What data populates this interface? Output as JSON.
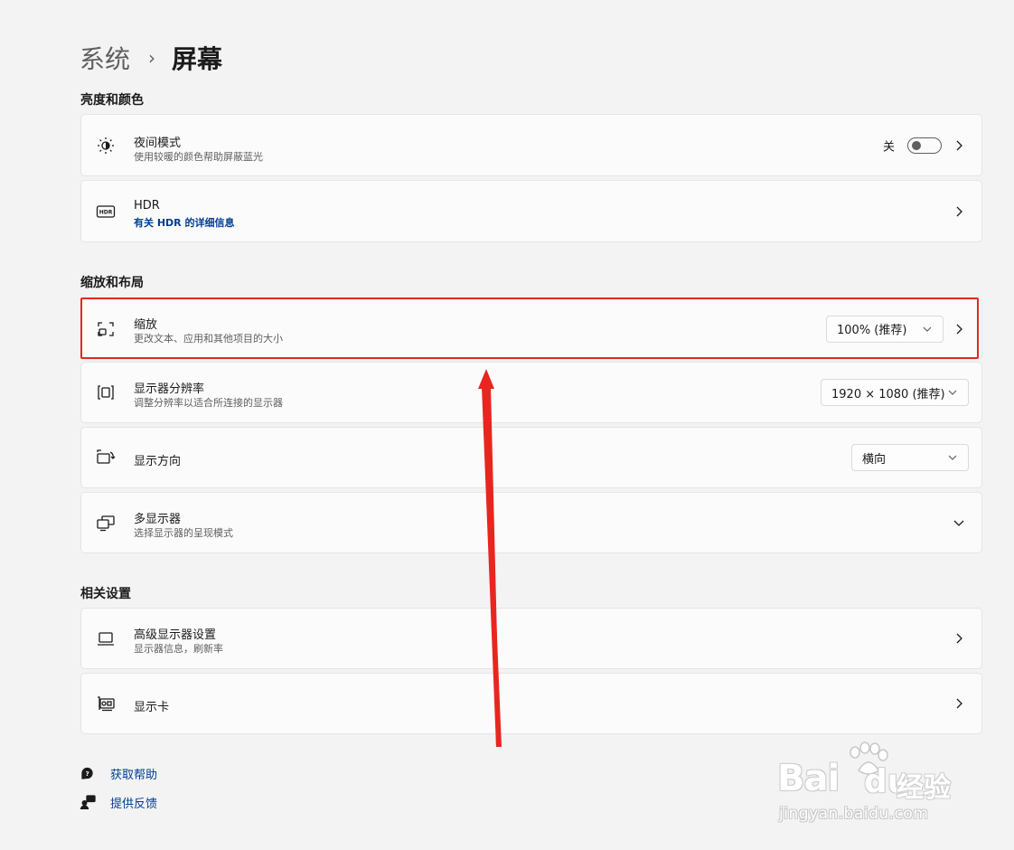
{
  "breadcrumb": {
    "parent": "系统",
    "separator": "›",
    "current": "屏幕"
  },
  "sections": {
    "brightness": "亮度和颜色",
    "scale_layout": "缩放和布局",
    "related": "相关设置"
  },
  "night_mode": {
    "title": "夜间模式",
    "subtitle": "使用较暖的颜色帮助屏蔽蓝光",
    "state_label": "关",
    "icon": "sun-moon-icon"
  },
  "hdr": {
    "title": "HDR",
    "subtitle": "有关 HDR 的详细信息",
    "icon": "hdr-icon"
  },
  "scale": {
    "title": "缩放",
    "subtitle": "更改文本、应用和其他项目的大小",
    "value": "100% (推荐)",
    "icon": "scale-icon"
  },
  "resolution": {
    "title": "显示器分辨率",
    "subtitle": "调整分辨率以适合所连接的显示器",
    "value": "1920 × 1080 (推荐)",
    "icon": "resolution-icon"
  },
  "orientation": {
    "title": "显示方向",
    "value": "横向",
    "icon": "orientation-icon"
  },
  "multi_display": {
    "title": "多显示器",
    "subtitle": "选择显示器的呈现模式",
    "icon": "multi-display-icon"
  },
  "advanced_display": {
    "title": "高级显示器设置",
    "subtitle": "显示器信息，刷新率",
    "icon": "laptop-icon"
  },
  "graphics": {
    "title": "显示卡",
    "icon": "graphics-card-icon"
  },
  "footer": {
    "help": "获取帮助",
    "feedback": "提供反馈"
  },
  "watermark": {
    "brand": "Bai",
    "brand2": "du",
    "brand_cn": "经验",
    "url": "jingyan.baidu.com"
  },
  "colors": {
    "accent_link": "#003e92",
    "highlight": "#e8261f",
    "background": "#f3f3f3",
    "card": "#fbfbfb"
  }
}
